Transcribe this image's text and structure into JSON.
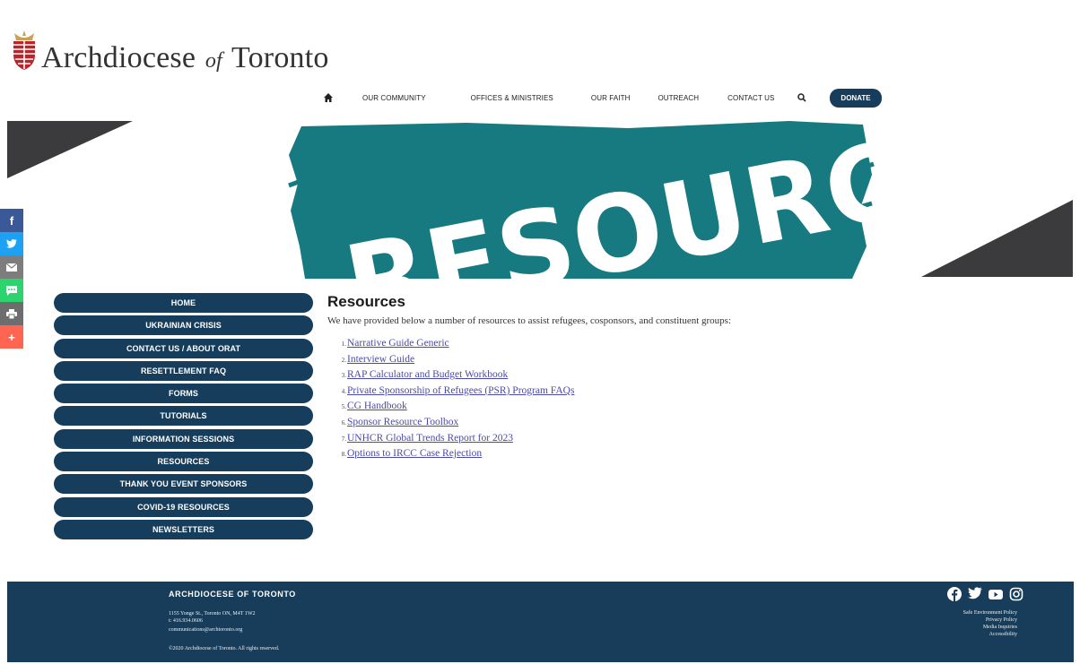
{
  "logo": {
    "part1": "Archdiocese",
    "part2": "of",
    "part3": "Toronto"
  },
  "nav": {
    "items": [
      "OUR COMMUNITY",
      "OFFICES & MINISTRIES",
      "OUR FAITH",
      "OUTREACH",
      "CONTACT US"
    ],
    "donate": "DONATE"
  },
  "banner": {
    "text": "RESOURCES"
  },
  "menu": [
    "HOME",
    "UKRAINIAN CRISIS",
    "CONTACT US / ABOUT ORAT",
    "RESETTLEMENT FAQ",
    "FORMS",
    "TUTORIALS",
    "INFORMATION SESSIONS",
    "RESOURCES",
    "THANK YOU EVENT SPONSORS",
    "COVID-19 RESOURCES",
    "NEWSLETTERS"
  ],
  "main": {
    "title": "Resources",
    "intro": "We have provided below a number of resources to assist refugees, cosponsors, and constituent groups:",
    "resources": [
      "Narrative Guide Generic",
      "Interview Guide",
      "RAP Calculator and Budget Workbook",
      "Private Sponsorship of Refugees (PSR) Program FAQs",
      "CG Handbook",
      "Sponsor Resource Toolbox",
      "UNHCR Global Trends Report for 2023",
      "Options to IRCC Case Rejection"
    ]
  },
  "social": [
    {
      "icon": "facebook-icon",
      "color": "#3b5998"
    },
    {
      "icon": "twitter-icon",
      "color": "#1da1f2"
    },
    {
      "icon": "email-icon",
      "color": "#7d7d7d"
    },
    {
      "icon": "sms-icon",
      "color": "#2bd46d"
    },
    {
      "icon": "print-icon",
      "color": "#6d6d6d"
    },
    {
      "icon": "more-icon",
      "color": "#ff6550"
    }
  ],
  "footer": {
    "title": "ARCHDIOCESE OF TORONTO",
    "address": "1155 Yonge St., Toronto ON, M4T 1W2",
    "phone": "t: 416.934.0606",
    "email": "communications@archtoronto.org",
    "copyright": "©2020 Archdiocese of Toronto. All rights reserved.",
    "links": [
      "Safe Environment Policy",
      "Privacy Policy",
      "Media Inquiries",
      "Accessibility"
    ]
  },
  "colors": {
    "navy": "#163d5b",
    "teal": "#177a80",
    "banner_gray": "#3b3b3d"
  }
}
